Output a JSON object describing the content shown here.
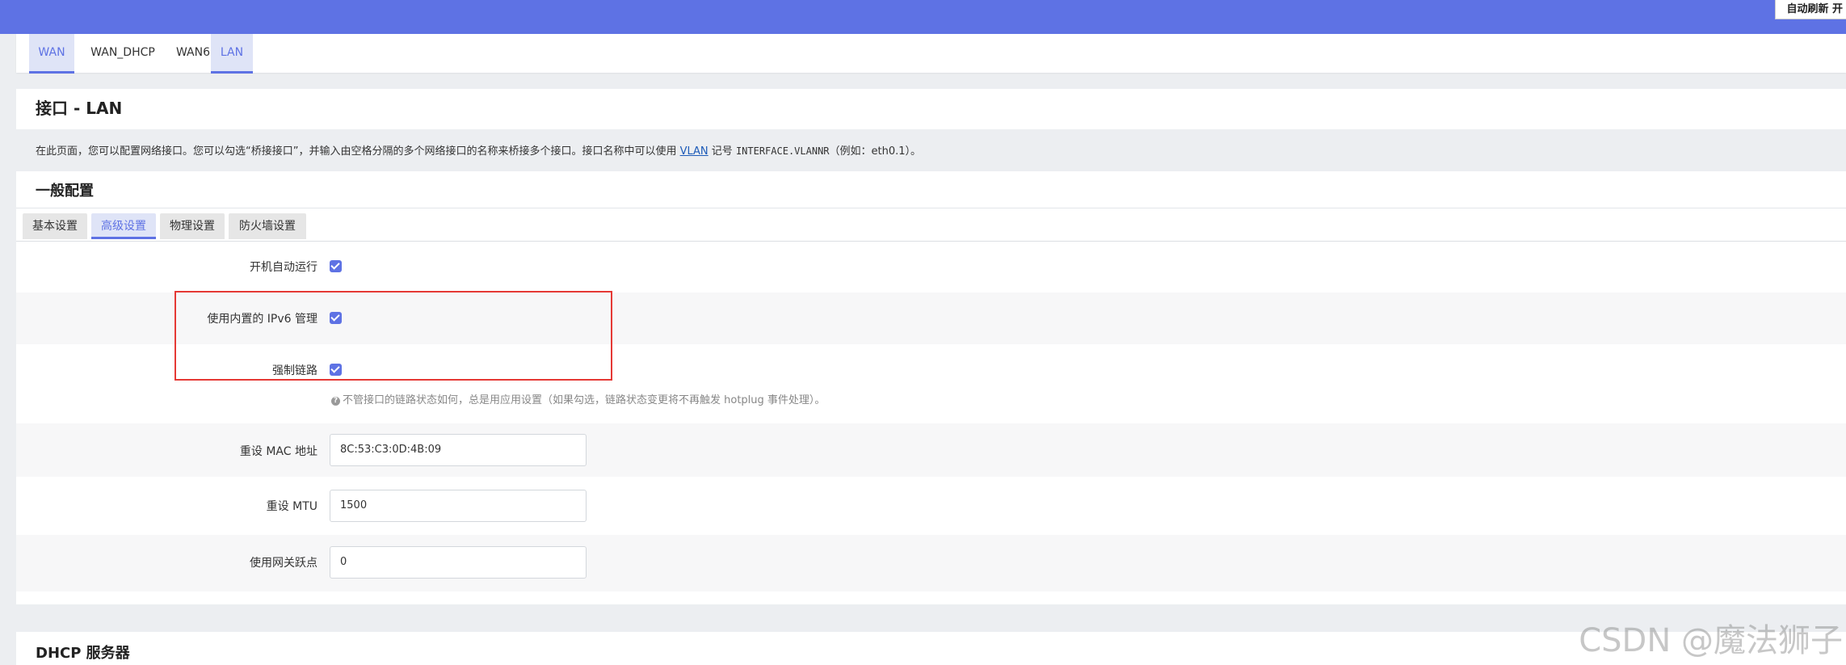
{
  "header": {
    "auto_refresh_label": "自动刷新 开"
  },
  "iface_tabs": [
    {
      "label": "WAN",
      "active": true
    },
    {
      "label": "WAN_DHCP",
      "active": false
    },
    {
      "label": "WAN6",
      "active": false
    },
    {
      "label": "LAN",
      "active": true
    }
  ],
  "page": {
    "title": "接口 - LAN",
    "description_prefix": "在此页面，您可以配置网络接口。您可以勾选“桥接接口”，并输入由空格分隔的多个网络接口的名称来桥接多个接口。接口名称中可以使用 ",
    "description_link": "VLAN",
    "description_mid": " 记号 ",
    "description_code": "INTERFACE.VLANNR",
    "description_suffix": "（例如：eth0.1）。"
  },
  "general": {
    "title": "一般配置",
    "subtabs": [
      {
        "label": "基本设置",
        "active": false
      },
      {
        "label": "高级设置",
        "active": true
      },
      {
        "label": "物理设置",
        "active": false
      },
      {
        "label": "防火墙设置",
        "active": false
      }
    ],
    "fields": {
      "autostart": {
        "label": "开机自动运行",
        "checked": true
      },
      "ipv6_mgmt": {
        "label": "使用内置的 IPv6 管理",
        "checked": true
      },
      "force_link": {
        "label": "强制链路",
        "checked": true,
        "hint": "不管接口的链路状态如何，总是用应用设置（如果勾选，链路状态变更将不再触发 hotplug 事件处理）。"
      },
      "mac": {
        "label": "重设 MAC 地址",
        "value": "8C:53:C3:0D:4B:09"
      },
      "mtu": {
        "label": "重设 MTU",
        "value": "1500"
      },
      "metric": {
        "label": "使用网关跃点",
        "value": "0"
      }
    }
  },
  "dhcp": {
    "title": "DHCP 服务器"
  },
  "watermark": "CSDN @魔法狮子",
  "colors": {
    "accent": "#5e72e4",
    "highlight": "#e53935"
  }
}
